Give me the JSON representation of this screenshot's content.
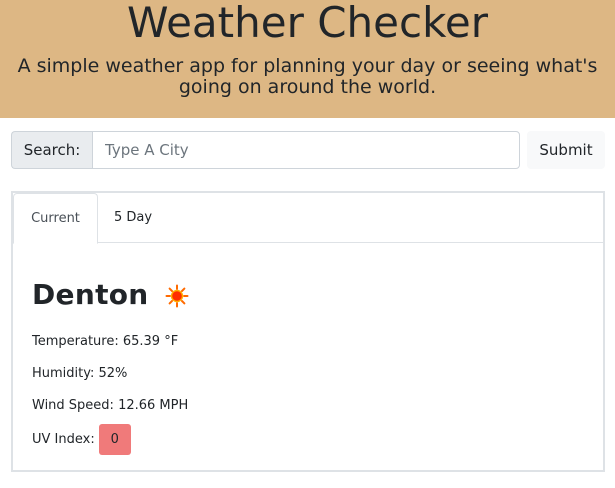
{
  "header": {
    "title": "Weather Checker",
    "subtitle": "A simple weather app for planning your day or seeing what's going on around the world.",
    "background_color": "#ddb784"
  },
  "search": {
    "label": "Search:",
    "placeholder": "Type A City",
    "value": "",
    "submit_label": "Submit"
  },
  "tabs": [
    {
      "label": "Current",
      "active": true
    },
    {
      "label": "5 Day",
      "active": false
    }
  ],
  "current": {
    "city": "Denton",
    "weather_icon": "sun-icon",
    "temperature": "Temperature: 65.39 °F",
    "humidity": "Humidity: 52%",
    "wind_speed": "Wind Speed: 12.66 MPH",
    "uv_label": "UV Index:",
    "uv_value": "0",
    "uv_color": "#f07a7a"
  }
}
